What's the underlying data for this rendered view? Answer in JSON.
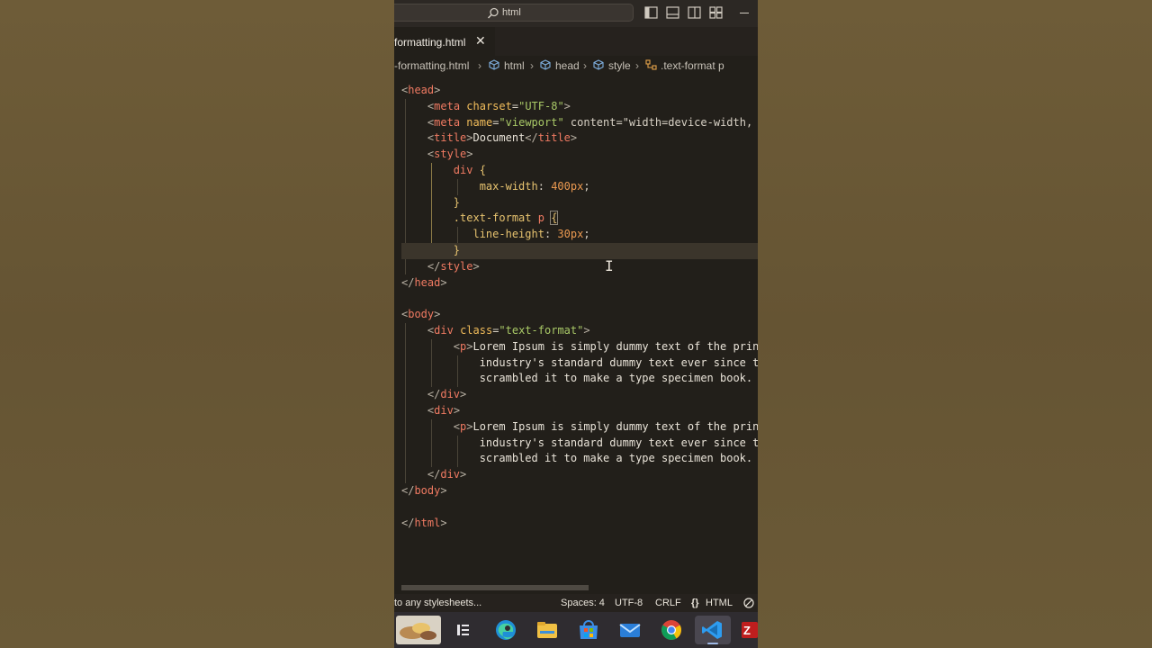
{
  "titlebar": {
    "search_text": "html",
    "icons": [
      "search-icon",
      "toggle-primary-sidebar-icon",
      "toggle-panel-icon",
      "toggle-secondary-sidebar-icon",
      "customize-layout-icon",
      "minimize-icon"
    ]
  },
  "tab": {
    "label": "formatting.html",
    "close": "✕"
  },
  "breadcrumb": {
    "items": [
      "-formatting.html",
      "html",
      "head",
      "style",
      ".text-format p"
    ],
    "separator": "›"
  },
  "editor": {
    "lines": [
      [
        "<head>"
      ],
      [
        "    <meta charset=\"UTF-8\">"
      ],
      [
        "    <meta name=\"viewport\" content=\"width=device-width,"
      ],
      [
        "    <title>Document</title>"
      ],
      [
        "    <style>"
      ],
      [
        "        div {"
      ],
      [
        "            max-width: 400px;"
      ],
      [
        "        }"
      ],
      [
        "        .text-format p {"
      ],
      [
        "           line-height: 30px;"
      ],
      [
        "        }"
      ],
      [
        "    </style>"
      ],
      [
        "</head>"
      ],
      [
        ""
      ],
      [
        "<body>"
      ],
      [
        "    <div class=\"text-format\">"
      ],
      [
        "        <p>Lorem Ipsum is simply dummy text of the prin"
      ],
      [
        "            industry's standard dummy text ever since t"
      ],
      [
        "            scrambled it to make a type specimen book."
      ],
      [
        "    </div>"
      ],
      [
        "    <div>"
      ],
      [
        "        <p>Lorem Ipsum is simply dummy text of the prin"
      ],
      [
        "            industry's standard dummy text ever since t"
      ],
      [
        "            scrambled it to make a type specimen book."
      ],
      [
        "    </div>"
      ],
      [
        "</body>"
      ],
      [
        ""
      ],
      [
        "</html>"
      ]
    ],
    "active_line": 10
  },
  "statusbar": {
    "message": "to any stylesheets...",
    "indent": "Spaces: 4",
    "encoding": "UTF-8",
    "eol": "CRLF",
    "language": "HTML",
    "language_icon": "braces-icon",
    "no_notifications_icon": "bell-slash-icon"
  },
  "taskbar": {
    "apps": [
      "widgets-icon",
      "task-view-icon",
      "edge-icon",
      "file-explorer-icon",
      "microsoft-store-icon",
      "mail-icon",
      "chrome-icon",
      "vscode-icon",
      "filezilla-icon"
    ],
    "active_app": "vscode-icon"
  },
  "colors": {
    "background": "#6b5a36",
    "editor_bg": "#221f1a",
    "tag": "#f07a62",
    "attribute": "#f2bd5b",
    "string": "#a9c967",
    "number": "#ec9a51",
    "active_line": "#3b352b"
  }
}
